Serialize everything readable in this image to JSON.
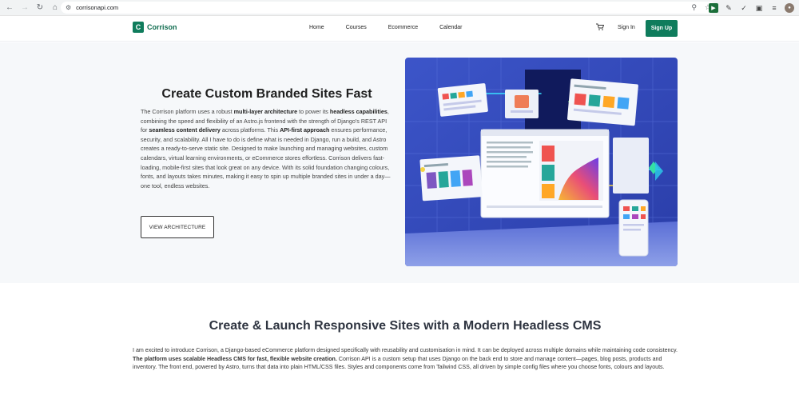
{
  "browser": {
    "url": "corrisonapi.com",
    "icons": {
      "back": "arrow-left-icon",
      "forward": "arrow-right-icon",
      "reload": "reload-icon",
      "home": "home-icon",
      "site_info": "tune-icon",
      "zoom": "magnifier-icon",
      "bookmark": "star-icon"
    }
  },
  "header": {
    "logo_letter": "C",
    "logo_text": "Corrison",
    "nav": [
      "Home",
      "Courses",
      "Ecommerce",
      "Calendar"
    ],
    "signin_label": "Sign In",
    "signup_label": "Sign Up",
    "brand_color": "#0f7c5c"
  },
  "hero": {
    "title": "Create Custom Branded Sites Fast",
    "p1": "The Corrison platform uses a robust ",
    "b1": "multi-layer architecture",
    "p2": " to power its ",
    "b2": "headless capabilities",
    "p3": ", combining the speed and flexibility of an Astro.js frontend with the strength of Django's REST API for ",
    "b3": "seamless content delivery",
    "p4": " across platforms. This ",
    "b4": "API-first approach",
    "p5": " ensures performance, security, and scalability. All I have to do is define what is needed in Django, run a build, and Astro creates a ready-to-serve static site. Designed to make launching and managing websites, custom calendars, virtual learning environments, or eCommerce stores effortless. Corrison delivers fast-loading, mobile-first sites that look great on any device. With its solid foundation changing colours, fonts, and layouts takes minutes, making it easy to spin up multiple branded sites in under a day—one tool, endless websites.",
    "cta_label": "VIEW ARCHITECTURE"
  },
  "section2": {
    "title": "Create & Launch Responsive Sites with a Modern Headless CMS",
    "p1": "I am excited to introduce Corrison, a Django-based eCommerce platform designed specifically with reusability and customisation in mind. It can be deployed across multiple domains while maintaining code consistency.  ",
    "b1": "The platform uses scalable Headless CMS for fast, flexible website creation.",
    "p2": " Corrison API is a custom setup that uses Django on the back end to store and manage content—pages, blog posts, products and inventory. The front end, powered by Astro, turns that data into plain HTML/CSS files. Styles and components come from Tailwind CSS, all driven by simple config files where you choose fonts, colours and layouts."
  }
}
